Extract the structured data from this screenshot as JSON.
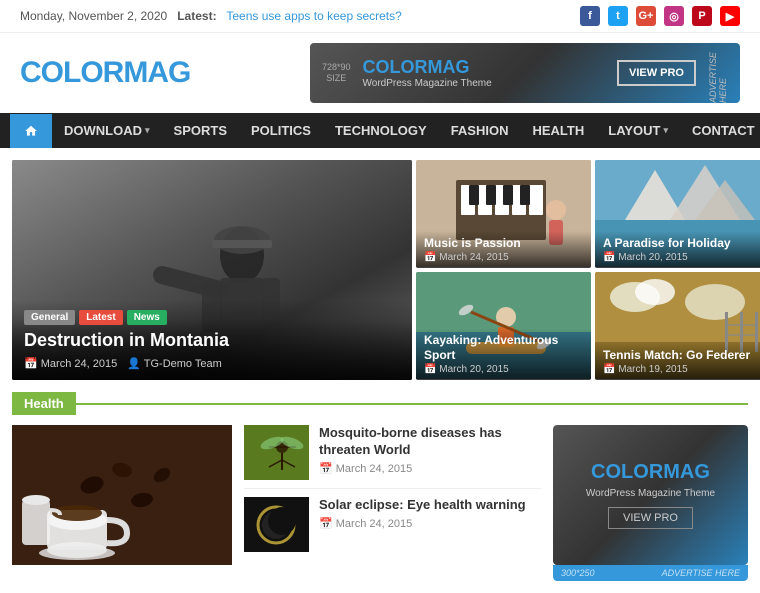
{
  "topbar": {
    "date": "Monday, November 2, 2020",
    "latest_label": "Latest:",
    "latest_link": "Teens use apps to keep secrets?",
    "social": [
      "fb",
      "tw",
      "gp",
      "ig",
      "pi",
      "yt"
    ]
  },
  "logo": {
    "color_part": "COLOR",
    "mag_part": "MAG"
  },
  "ad_banner": {
    "size": "728*90\nSIZE",
    "brand_color": "COLOR",
    "brand_mag": "MAG",
    "sub": "WordPress Magazine Theme",
    "btn": "VIEW PRO",
    "tag": "ADVERTISE HERE"
  },
  "nav": {
    "home_label": "Home",
    "items": [
      {
        "label": "DOWNLOAD",
        "has_dropdown": true
      },
      {
        "label": "SPORTS",
        "has_dropdown": false
      },
      {
        "label": "POLITICS",
        "has_dropdown": false
      },
      {
        "label": "TECHNOLOGY",
        "has_dropdown": false
      },
      {
        "label": "FASHION",
        "has_dropdown": false
      },
      {
        "label": "HEALTH",
        "has_dropdown": false
      },
      {
        "label": "LAYOUT",
        "has_dropdown": true
      },
      {
        "label": "CONTACT",
        "has_dropdown": false
      }
    ]
  },
  "featured": {
    "main": {
      "badges": [
        "General",
        "Latest",
        "News"
      ],
      "title": "Destruction in Montania",
      "date": "March 24, 2015",
      "author": "TG-Demo Team"
    },
    "side_items": [
      {
        "title": "Music is Passion",
        "date": "March 24, 2015",
        "img": "piano"
      },
      {
        "title": "A Paradise for Holiday",
        "date": "March 20, 2015",
        "img": "cliffs"
      },
      {
        "title": "Kayaking: Adventurous Sport",
        "date": "March 20, 2015",
        "img": "kayak"
      },
      {
        "title": "Tennis Match: Go Federer",
        "date": "March 19, 2015",
        "img": "tennis"
      }
    ]
  },
  "health_section": {
    "label": "Health",
    "articles": [
      {
        "title": "Mosquito-borne diseases has threaten World",
        "date": "March 24, 2015",
        "img": "mosquito"
      },
      {
        "title": "Solar eclipse: Eye health warning",
        "date": "March 24, 2015",
        "img": "eclipse"
      }
    ]
  },
  "sidebar_ad": {
    "brand_color": "COLOR",
    "brand_mag": "MAG",
    "sub": "WordPress Magazine Theme",
    "btn": "VIEW PRO",
    "size": "300*250",
    "tag": "ADVERTISE HERE"
  }
}
